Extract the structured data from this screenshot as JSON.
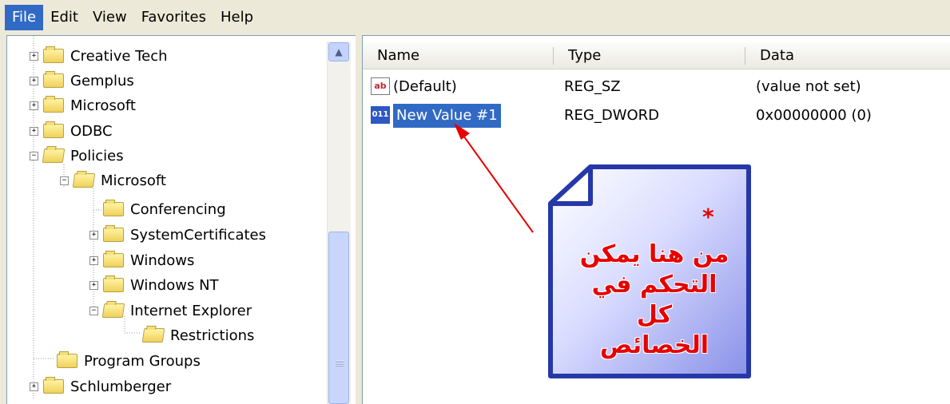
{
  "menu": [
    {
      "label": "File",
      "active": true
    },
    {
      "label": "Edit",
      "active": false
    },
    {
      "label": "View",
      "active": false
    },
    {
      "label": "Favorites",
      "active": false
    },
    {
      "label": "Help",
      "active": false
    }
  ],
  "tree": [
    {
      "label": "Creative Tech",
      "expander": "+"
    },
    {
      "label": "Gemplus",
      "expander": "+"
    },
    {
      "label": "Microsoft",
      "expander": "+"
    },
    {
      "label": "ODBC",
      "expander": "+"
    },
    {
      "label": "Policies",
      "expander": "−"
    },
    {
      "label": "Microsoft",
      "expander": "−"
    },
    {
      "label": "Conferencing",
      "expander": ""
    },
    {
      "label": "SystemCertificates",
      "expander": "+"
    },
    {
      "label": "Windows",
      "expander": "+"
    },
    {
      "label": "Windows NT",
      "expander": "+"
    },
    {
      "label": "Internet Explorer",
      "expander": "−"
    },
    {
      "label": "Restrictions",
      "expander": ""
    },
    {
      "label": "Program Groups",
      "expander": ""
    },
    {
      "label": "Schlumberger",
      "expander": "+"
    }
  ],
  "list": {
    "columns": [
      "Name",
      "Type",
      "Data"
    ],
    "rows": [
      {
        "icon": "ab",
        "name": "(Default)",
        "type": "REG_SZ",
        "data": "(value not set)",
        "selected": false
      },
      {
        "icon": "011",
        "name": "New Value #1",
        "type": "REG_DWORD",
        "data": "0x00000000 (0)",
        "selected": true
      }
    ]
  },
  "callout": {
    "star": "*",
    "text": "من هنا يمكن التحكم في كل الخصائص"
  },
  "colors": {
    "selection": "#316ac5",
    "note_border": "#2638a8",
    "annotation_red": "#e60000"
  }
}
